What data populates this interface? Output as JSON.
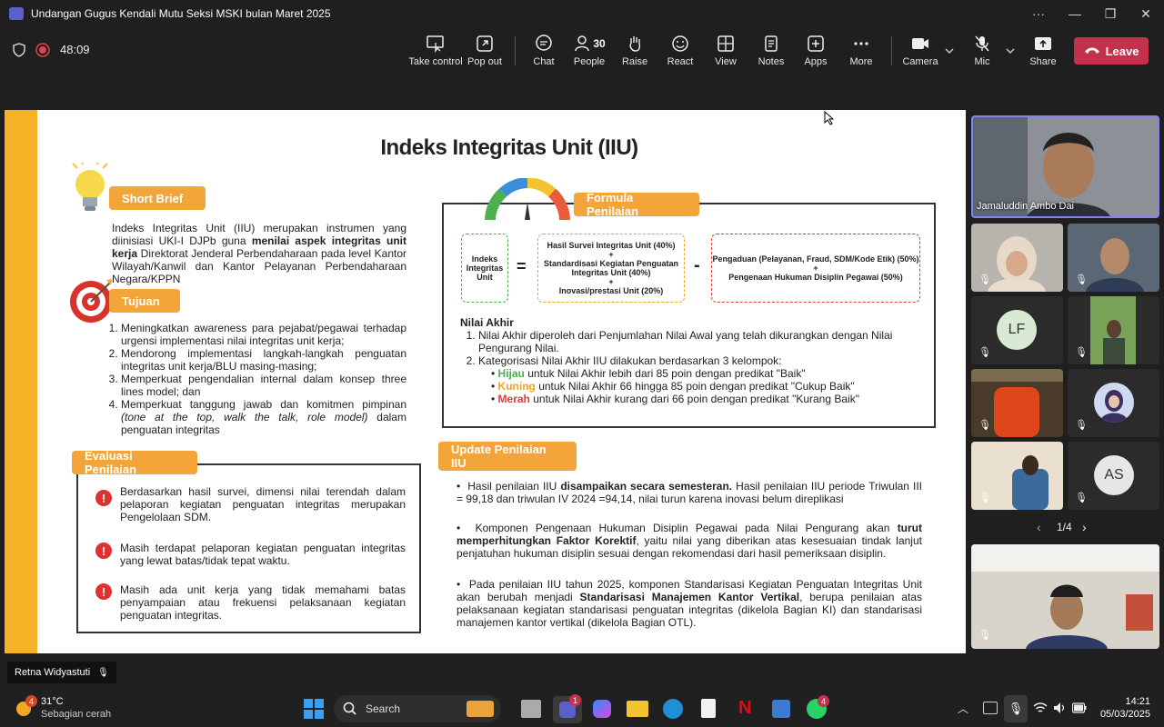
{
  "window": {
    "title": "Undangan Gugus Kendali Mutu Seksi MSKI bulan Maret 2025",
    "more": "···",
    "minimize": "—",
    "maximize": "❐",
    "close": "✕"
  },
  "meeting": {
    "timer": "48:09",
    "toolbar": {
      "take_control": "Take control",
      "pop_out": "Pop out",
      "chat": "Chat",
      "people": "People",
      "people_count": "30",
      "raise": "Raise",
      "react": "React",
      "view": "View",
      "notes": "Notes",
      "apps": "Apps",
      "more": "More",
      "camera": "Camera",
      "mic": "Mic",
      "share": "Share",
      "leave": "Leave"
    },
    "leave_color": "#c4314b"
  },
  "slide": {
    "title": "Indeks Integritas Unit (IIU)",
    "short_brief": {
      "heading": "Short Brief",
      "text_1": "Indeks Integritas Unit (IIU) merupakan instrumen yang diinisiasi UKI-I DJPb guna ",
      "text_bold": "menilai aspek integritas unit kerja",
      "text_2": " Direktorat Jenderal Perbendaharaan pada level Kantor Wilayah/Kanwil dan Kantor Pelayanan Perbendaharaan Negara/KPPN"
    },
    "tujuan": {
      "heading": "Tujuan",
      "items": [
        "Meningkatkan awareness para pejabat/pegawai terhadap urgensi implementasi nilai integritas unit kerja;",
        "Mendorong implementasi langkah-langkah penguatan integritas unit kerja/BLU masing-masing;",
        "Memperkuat pengendalian internal dalam konsep three lines model; dan"
      ],
      "item4_a": "Memperkuat tanggung jawab dan komitmen pimpinan ",
      "item4_italic": "(tone at the top, walk the talk, role model)",
      "item4_b": " dalam penguatan integritas"
    },
    "evaluasi": {
      "heading": "Evaluasi Penilaian",
      "items": [
        "Berdasarkan hasil survei, dimensi nilai terendah dalam pelaporan kegiatan penguatan integritas merupakan Pengelolaan SDM.",
        "Masih terdapat pelaporan kegiatan penguatan integritas yang lewat batas/tidak tepat waktu.",
        "Masih ada unit kerja yang tidak memahami batas penyampaian atau frekuensi pelaksanaan kegiatan penguatan integritas."
      ]
    },
    "formula": {
      "heading": "Formula Penilaian",
      "iiu": "Indeks Integritas Unit",
      "equals": "=",
      "minus": "-",
      "plus": "+",
      "green_box": [
        "Hasil Survei Integritas Unit (40%)",
        "Standardisasi Kegiatan Penguatan Integritas Unit (40%)",
        "Inovasi/prestasi Unit (20%)"
      ],
      "red_box": [
        "Pengaduan (Pelayanan, Fraud, SDM/Kode Etik) (50%)",
        "Pengenaan Hukuman Disiplin Pegawai (50%)"
      ],
      "nilai_akhir_heading": "Nilai Akhir",
      "nilai_akhir_1": "Nilai Akhir diperoleh dari Penjumlahan Nilai Awal yang telah dikurangkan dengan Nilai Pengurang Nilai.",
      "nilai_akhir_2": "Kategorisasi Nilai Akhir IIU dilakukan berdasarkan 3 kelompok:",
      "categories": [
        {
          "name": "Hijau",
          "text": " untuk Nilai Akhir lebih dari 85 poin dengan predikat \"Baik\"",
          "color": "#4caf50"
        },
        {
          "name": "Kuning",
          "text": " untuk Nilai Akhir 66 hingga 85 poin dengan predikat \"Cukup Baik\"",
          "color": "#f4a41a"
        },
        {
          "name": "Merah",
          "text": " untuk Nilai Akhir kurang dari 66 poin dengan predikat \"Kurang Baik\"",
          "color": "#e53935"
        }
      ]
    },
    "update": {
      "heading": "Update Penilaian IIU",
      "b1_a": "Hasil penilaian IIU ",
      "b1_bold": "disampaikan secara semesteran.",
      "b1_b": " Hasil penilaian IIU periode Triwulan III = 99,18 dan triwulan IV 2024 =94,14, nilai turun karena inovasi belum direplikasi",
      "b2_a": "Komponen Pengenaan Hukuman Disiplin Pegawai pada Nilai Pengurang akan ",
      "b2_bold": "turut memperhitungkan Faktor Korektif",
      "b2_b": ", yaitu nilai yang diberikan atas kesesuaian tindak lanjut penjatuhan hukuman disiplin sesuai dengan rekomendasi dari hasil pemeriksaan disiplin.",
      "b3_a": "Pada penilaian IIU tahun 2025, komponen Standarisasi Kegiatan Penguatan Integritas Unit akan berubah menjadi ",
      "b3_bold": "Standarisasi Manajemen Kantor Vertikal",
      "b3_b": ", berupa penilaian atas pelaksanaan kegiatan standarisasi penguatan integritas (dikelola Bagian KI) dan standarisasi manajemen kantor vertikal (dikelola Bagian OTL)."
    },
    "accent_color": "#f4a53a"
  },
  "participants": {
    "featured_name": "Jamaluddin Ambo Dai",
    "initials_lf": "LF",
    "initials_as": "AS",
    "page": "1/4",
    "presenter_name": "Retna Widyastuti"
  },
  "taskbar": {
    "weather_temp": "31°C",
    "weather_desc": "Sebagian cerah",
    "weather_badge": "4",
    "search": "Search",
    "teams_badge": "1",
    "whatsapp_badge": "4",
    "time": "14:21",
    "date": "05/03/2025"
  }
}
